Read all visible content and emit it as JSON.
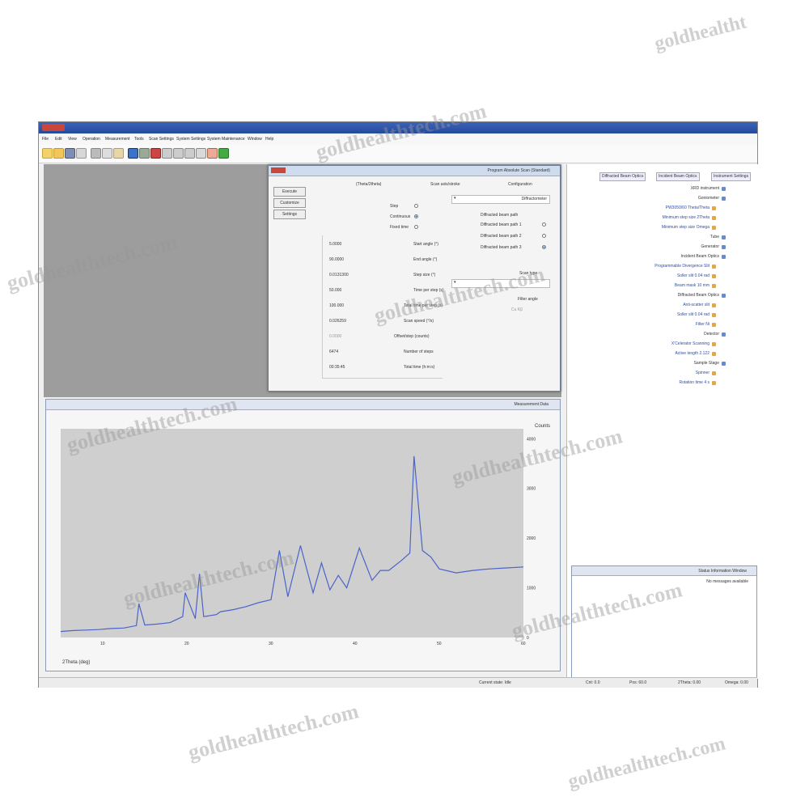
{
  "window": {
    "title": "",
    "menu": [
      "File",
      "Edit",
      "View",
      "Operation",
      "Measurement",
      "Tools",
      "Scan Settings",
      "System Settings",
      "System Maintenance",
      "Window",
      "Help"
    ]
  },
  "dialog": {
    "title": "Program Absolute Scan (Standard)",
    "buttons": [
      "Execute",
      "Customize",
      "Settings"
    ],
    "scan_axis_label": "Scan axis/stroke",
    "scan_axis_value": "(Theta/2theta)",
    "configuration_label": "Configuration",
    "configuration_value": "Diffractometer",
    "scan_mode_options": [
      "Step",
      "Continuous",
      "Fixed time"
    ],
    "scan_mode_selected": 1,
    "beam_path_label": "Diffracted beam path",
    "beam_options": [
      "Diffracted beam path 1",
      "Diffracted beam path 2",
      "Diffracted beam path 3"
    ],
    "beam_selected": 2,
    "params": [
      {
        "label": "Start angle (°)",
        "value": "5.0000"
      },
      {
        "label": "End angle (°)",
        "value": "90.0000"
      },
      {
        "label": "Step size (°)",
        "value": "0.0131300"
      },
      {
        "label": "Time per step (s)",
        "value": "50.000"
      },
      {
        "label": "Total time per step (s)",
        "value": "100.000"
      },
      {
        "label": "Scan speed (°/s)",
        "value": "0.026259"
      },
      {
        "label": "Offset/step (counts)",
        "value": "0.0000"
      },
      {
        "label": "Number of steps",
        "value": "6474"
      },
      {
        "label": "Total time (h:m:s)",
        "value": "00:35:45"
      }
    ],
    "scan_type_label": "Scan type",
    "filter_label": "Filter angle",
    "filter_value": "Cu Kβ"
  },
  "plot": {
    "title": "Measurement Data",
    "xlabel": "2Theta (deg)",
    "ylabel": "Counts",
    "yticks": [
      "0",
      "1000",
      "2000",
      "3000",
      "4000"
    ]
  },
  "chart_data": {
    "type": "line",
    "title": "",
    "xlabel": "2Theta (deg)",
    "ylabel": "Counts",
    "xlim": [
      5,
      60
    ],
    "ylim": [
      0,
      4200
    ],
    "series": [
      {
        "x": [
          5,
          6.5,
          8,
          9.5,
          11,
          12.5,
          14,
          14.3,
          15,
          16.5,
          18,
          19.5,
          19.8,
          21,
          21.5,
          22,
          23.5,
          24,
          25.5,
          27,
          28.5,
          30,
          31,
          32,
          33.5,
          35,
          36,
          37,
          38,
          39,
          40.5,
          42,
          43,
          44,
          45.5,
          46.5,
          47,
          48,
          49,
          50,
          52,
          54,
          56,
          58,
          60
        ],
        "y": [
          120,
          140,
          150,
          160,
          180,
          190,
          240,
          680,
          250,
          270,
          300,
          420,
          900,
          380,
          1280,
          420,
          460,
          520,
          560,
          620,
          700,
          760,
          1750,
          820,
          1850,
          900,
          1500,
          960,
          1250,
          1000,
          1800,
          1150,
          1350,
          1350,
          1550,
          1700,
          3650,
          1750,
          1620,
          1380,
          1300,
          1350,
          1380,
          1400,
          1420
        ]
      }
    ],
    "grid": false,
    "legend": "none"
  },
  "right_panel": {
    "tabs": [
      "Instrument Settings",
      "Incident Beam Optics",
      "Diffracted Beam Optics"
    ],
    "tree": [
      {
        "text": "XRD instrument",
        "blue": false
      },
      {
        "text": "Goniometer",
        "blue": false
      },
      {
        "text": "PW3050/60 Theta/Theta",
        "blue": true
      },
      {
        "text": "Minimum step size 2Theta",
        "blue": true
      },
      {
        "text": "Minimum step size Omega",
        "blue": true
      },
      {
        "text": "Tube",
        "blue": false
      },
      {
        "text": "Generator",
        "blue": false
      },
      {
        "text": "Incident Beam Optics",
        "blue": false
      },
      {
        "text": "Programmable Divergence Slit",
        "blue": true
      },
      {
        "text": "Soller slit 0.04 rad",
        "blue": true
      },
      {
        "text": "Beam mask 10 mm",
        "blue": true
      },
      {
        "text": "Diffracted Beam Optics",
        "blue": false
      },
      {
        "text": "Anti-scatter slit",
        "blue": true
      },
      {
        "text": "Soller slit 0.04 rad",
        "blue": true
      },
      {
        "text": "Filter Ni",
        "blue": true
      },
      {
        "text": "Detector",
        "blue": false
      },
      {
        "text": "X'Celerator Scanning",
        "blue": true
      },
      {
        "text": "Active length 2.122",
        "blue": true
      },
      {
        "text": "Sample Stage",
        "blue": false
      },
      {
        "text": "Spinner",
        "blue": true
      },
      {
        "text": "Rotation time 4 s",
        "blue": true
      }
    ]
  },
  "messages": {
    "title": "Status Information Window",
    "text": "No messages available"
  },
  "statusbar": [
    "Current state: Idle",
    "Cnt: 0.0",
    "Pos: 60.0",
    "2Theta: 0.00",
    "Omega: 0.00"
  ],
  "watermark": "goldhealthtech.com",
  "watermark_corner": "goldhealtht",
  "colors": {
    "series": "#4a64c8",
    "plot_bg": "#cfcfcf",
    "title_bar": "#2f56ad"
  }
}
